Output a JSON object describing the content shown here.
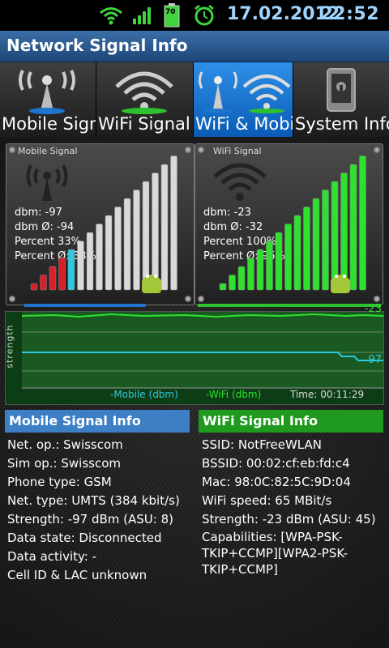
{
  "status": {
    "date": "17.02.2012",
    "time": "22:52",
    "battery": "70"
  },
  "app": {
    "title": "Network Signal Info"
  },
  "tabs": [
    {
      "label": "Mobile Signal",
      "active": false
    },
    {
      "label": "WiFi Signal",
      "active": false
    },
    {
      "label": "WiFi & Mobile",
      "active": true
    },
    {
      "label": "System Info",
      "active": false
    }
  ],
  "mobile_panel": {
    "title": "Mobile Signal",
    "dbm": "dbm: -97",
    "dbm_avg": "dbm Ø: -94",
    "percent": "Percent 33%",
    "percent_avg": "Percent Ø: 38%",
    "level_percent": 33
  },
  "wifi_panel": {
    "title": "WiFi Signal",
    "dbm": "dbm: -23",
    "dbm_avg": "dbm Ø: -32",
    "percent": "Percent 100%",
    "percent_avg": "Percent Ø: 96%",
    "level_percent": 100
  },
  "graph": {
    "ylabel": "strength",
    "wifi_value": "-23",
    "mobile_value": "-97",
    "legend_mobile": "-Mobile (dbm)",
    "legend_wifi": "-WiFi (dbm)",
    "time": "Time: 00:11:29"
  },
  "mobile_info": {
    "header": "Mobile Signal Info",
    "lines": [
      "Net. op.: Swisscom",
      "Sim op.: Swisscom",
      "Phone type: GSM",
      "Net. type: UMTS (384 kbit/s)",
      "Strength: -97 dBm (ASU: 8)",
      "Data state: Disconnected",
      "Data activity: -",
      "Cell ID & LAC unknown"
    ]
  },
  "wifi_info": {
    "header": "WiFi Signal Info",
    "lines": [
      "SSID: NotFreeWLAN",
      "BSSID: 00:02:cf:eb:fd:c4",
      "Mac: 98:0C:82:5C:9D:04",
      "WiFi speed: 65 MBit/s",
      "Strength: -23 dBm (ASU: 45)",
      "Capabilities: [WPA-PSK-",
      "TKIP+CCMP][WPA2-PSK-",
      "TKIP+CCMP]"
    ]
  },
  "colors": {
    "mobile_header": "#3d7fc4",
    "wifi_header": "#1f9a1f",
    "tab_active": "#1b73d0",
    "mobile_line": "#2ec8e0",
    "wifi_line": "#2fe02f"
  }
}
